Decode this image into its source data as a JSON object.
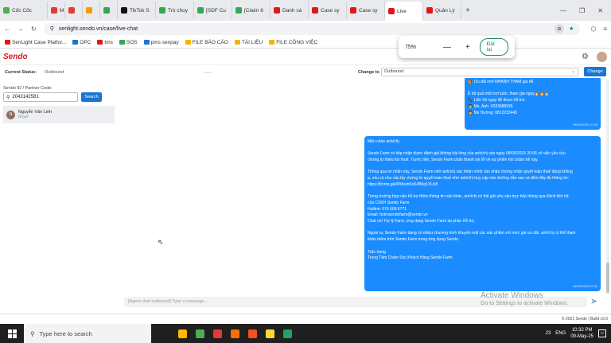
{
  "browser": {
    "tabs": [
      {
        "label": "Cốc Cốc",
        "color": "#4caf50"
      },
      {
        "label": "M",
        "color": "#e53935"
      },
      {
        "label": "",
        "color": "#e53935"
      },
      {
        "label": "",
        "color": "#ff9800"
      },
      {
        "label": "",
        "color": "#34a853"
      },
      {
        "label": "TikTok S",
        "color": "#111111"
      },
      {
        "label": "Trò chuy",
        "color": "#34a853"
      },
      {
        "label": "[SDF Cu",
        "color": "#34a853"
      },
      {
        "label": "[Claim 8",
        "color": "#34a853"
      },
      {
        "label": "Danh sá",
        "color": "#e3161c"
      },
      {
        "label": "Case sy",
        "color": "#e3161c"
      },
      {
        "label": "Case sy",
        "color": "#e3161c"
      },
      {
        "label": "Live",
        "color": "#e3161c"
      },
      {
        "label": "Quản Lý",
        "color": "#e3161c"
      }
    ],
    "url": "senlight.sendo.vn/case/live-chat",
    "bookmarks": [
      "SenLight Case Platfor...",
      "OPC",
      "tms",
      "SOS",
      "pms senpay",
      "FILE BÁO CÁO",
      "TÀI LIỆU",
      "FILE CÔNG VIỆC"
    ],
    "zoom": {
      "value": "75%",
      "minus": "—",
      "plus": "+",
      "reset": "Đặt lại"
    }
  },
  "app": {
    "logo": "Sendo",
    "current_status_label": "Current Status:",
    "current_status_value": "Outbound",
    "more": "····",
    "change_to_label": "Change to",
    "change_to_value": "Outbound",
    "change_button": "Change",
    "partner_label": "Sendo ID / Partner Code:",
    "search_value": "2043142581",
    "search_button": "Search",
    "customer": {
      "initial": "N",
      "name": "Nguyễn Văn Linh",
      "tag": "Buyer"
    },
    "input_placeholder": "[Agent chat outbound] Type a message...",
    "footer": "© 2021 Sendo | Build v3.0"
  },
  "messages": [
    {
      "lines": [
        "🎁 Ưu đãi mới NHANH THAM gia để",
        "",
        "Ề tất quả một trợt luồn, tham gia ngay🔥🔥🔥",
        "📞 Liên hệ ngay để được hỗ trợ:",
        "👩 Ms. Ánh: 0333688926",
        "👩 Ms Hường: 0812233445"
      ],
      "time": "09/05/2025 10:08"
    },
    {
      "lines": [
        "Mến chào anh/chị,",
        "",
        "Sendo Farm có tiếp nhận được đánh giá không hài lòng của anh/chị vào ngày 08/05/2025 20:06 về việc yêu cầu",
        "chứng từ thiếu trừ thuế. Trước tiên, Sendo Farm chân thành xin lỗi về sự phiền hồi chậm trễ này.",
        "",
        "Thông qua tin nhắn này, Sendo Farm nhờ anh/chị xác nhận mình cần nhận chứng nhận quyết toán thuế đúng không",
        "ạ, nếu có nhu cầu lấy chứng từ quyết toán thuế nhờ anh/chị truy cập vào đường dẫn sau và điền đầy đủ thông tin:",
        "https://forms.gle/PMvoh5oK4B9q1XUx8",
        "",
        "Trong trường hợp cần hỗ trợ thêm thông tin nào khác, anh/chị có thể gửi yêu cầu trực tiếp thông qua Kênh liên hệ",
        "của CSKH Sendo Farm",
        "Hotline: 076 600 6771",
        "Email: hotrosendofarm@sendo.vn",
        "Chat với Trợ lý Farm, ứng dụng Sendo Farm tại phần Hỗ trợ.",
        "",
        "Ngoài ra, Sendo Farm đang có nhiều chương trình khuyến mãi các sản phẩm với mức giá ưu đãi, anh/chị có thể tham",
        "khảo thêm trên Sendo Farm trong ứng dụng Sendo.",
        "",
        "Trân trọng",
        "Trung Tâm Chăm Sóc Khách Hàng Sendo Farm"
      ],
      "time": "09/05/2025 22:32"
    }
  ],
  "watermark": {
    "title": "Activate Windows",
    "sub": "Go to Settings to activate Windows."
  },
  "taskbar": {
    "search": "Type here to search",
    "weather": "23",
    "time": "10:32 PM",
    "date": "09-May-25",
    "lang": "ENG",
    "apps": [
      "#ffb900",
      "#4caf50",
      "#e53935",
      "#ff6d00",
      "#f4511e",
      "#fdd835",
      "#21a366"
    ]
  }
}
